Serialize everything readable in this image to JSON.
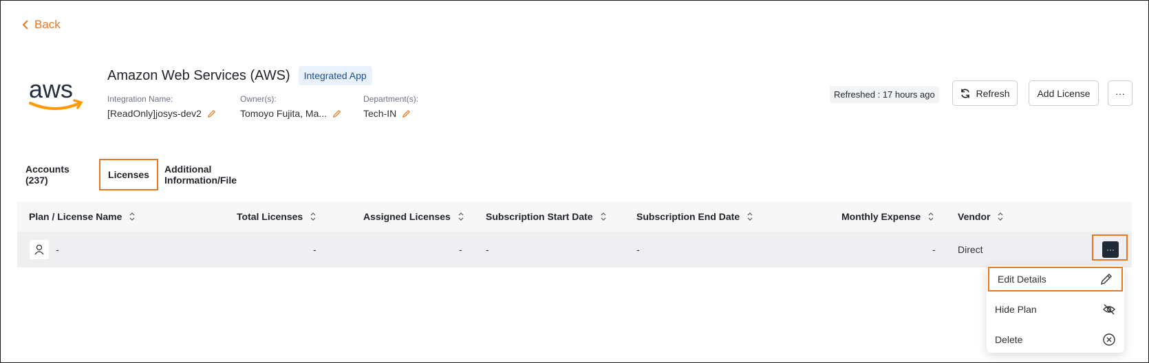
{
  "nav": {
    "back_label": "Back"
  },
  "app": {
    "title": "Amazon Web Services (AWS)",
    "badge": "Integrated App",
    "integration_label": "Integration Name:",
    "integration_value": "[ReadOnly]josys-dev2",
    "owner_label": "Owner(s):",
    "owner_value": "Tomoyo Fujita, Ma...",
    "department_label": "Department(s):",
    "department_value": "Tech-IN"
  },
  "header": {
    "refreshed": "Refreshed : 17 hours ago",
    "refresh_label": "Refresh",
    "add_license_label": "Add License",
    "more_label": "···"
  },
  "tabs": [
    {
      "label": "Accounts (237)"
    },
    {
      "label": "Licenses"
    },
    {
      "label": "Additional Information/File"
    }
  ],
  "table": {
    "columns": [
      "Plan / License Name",
      "Total Licenses",
      "Assigned Licenses",
      "Subscription Start Date",
      "Subscription End Date",
      "Monthly Expense",
      "Vendor"
    ],
    "rows": [
      {
        "plan": "-",
        "total": "-",
        "assigned": "-",
        "start": "-",
        "end": "-",
        "expense": "-",
        "vendor": "Direct"
      }
    ],
    "row_action": "···"
  },
  "menu": {
    "items": [
      {
        "label": "Edit Details",
        "icon": "pencil-icon"
      },
      {
        "label": "Hide Plan",
        "icon": "eye-off-icon"
      },
      {
        "label": "Delete",
        "icon": "x-circle-icon"
      }
    ]
  },
  "colors": {
    "accent": "#e87722",
    "badge_bg": "#e8f1fc",
    "badge_text": "#1d4f91",
    "aws_orange": "#ff9900",
    "aws_dark": "#232f3e"
  }
}
